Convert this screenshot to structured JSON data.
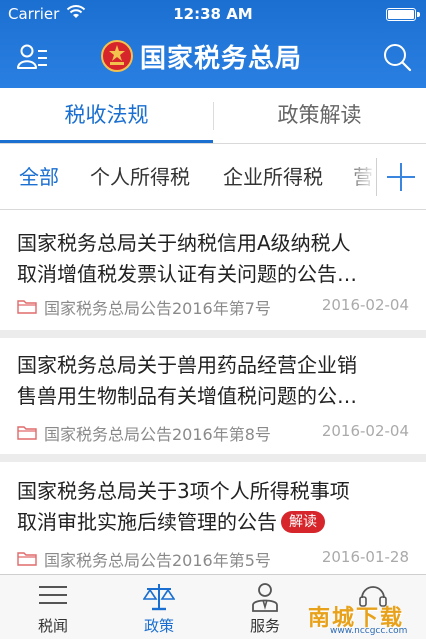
{
  "status": {
    "carrier": "Carrier",
    "time": "12:38 AM"
  },
  "header": {
    "title": "国家税务总局",
    "brand_color": "#1b6fd1"
  },
  "tabs": [
    {
      "label": "税收法规",
      "active": true
    },
    {
      "label": "政策解读",
      "active": false
    }
  ],
  "categories": [
    {
      "label": "全部",
      "selected": true
    },
    {
      "label": "个人所得税",
      "selected": false
    },
    {
      "label": "企业所得税",
      "selected": false
    },
    {
      "label": "营",
      "selected": false
    }
  ],
  "articles": [
    {
      "title_lines": [
        "国家税务总局关于纳税信用A级纳税人",
        "取消增值税发票认证有关问题的公告…"
      ],
      "source": "国家税务总局公告2016年第7号",
      "date": "2016-02-04"
    },
    {
      "title_lines": [
        "国家税务总局关于兽用药品经营企业销",
        "售兽用生物制品有关增值税问题的公…"
      ],
      "source": "国家税务总局公告2016年第8号",
      "date": "2016-02-04"
    },
    {
      "title_lines": [
        "国家税务总局关于3项个人所得税事项",
        "取消审批实施后续管理的公告"
      ],
      "badge": "解读",
      "source": "国家税务总局公告2016年第5号",
      "date": "2016-01-28"
    }
  ],
  "bottom_nav": [
    {
      "label": "税闻",
      "icon": "news-list-icon",
      "active": false
    },
    {
      "label": "政策",
      "icon": "scales-icon",
      "active": true
    },
    {
      "label": "服务",
      "icon": "service-person-icon",
      "active": false
    },
    {
      "label": "",
      "icon": "headset-icon",
      "active": false
    }
  ],
  "watermark": {
    "text": "南城下载",
    "url": "www.nccgcc.com"
  }
}
